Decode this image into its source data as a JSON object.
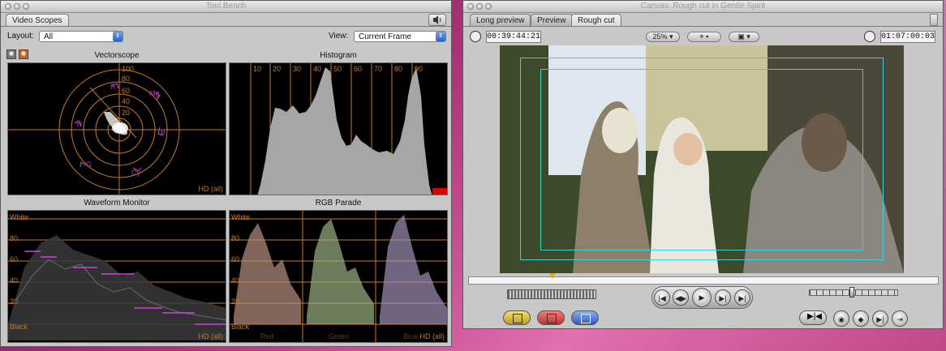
{
  "tool_bench": {
    "title": "Tool Bench",
    "tab": "Video Scopes",
    "layout_label": "Layout:",
    "layout_value": "All",
    "view_label": "View:",
    "view_value": "Current Frame",
    "vectorscope": {
      "title": "Vectorscope",
      "ring_labels": [
        "100",
        "80",
        "60",
        "40",
        "20"
      ],
      "targets": [
        "R",
        "Mg",
        "B",
        "Cy",
        "G",
        "Yl"
      ],
      "corner": "HD (all)"
    },
    "histogram": {
      "title": "Histogram",
      "ticks": [
        "10",
        "20",
        "30",
        "40",
        "50",
        "60",
        "70",
        "80",
        "90"
      ]
    },
    "waveform": {
      "title": "Waveform Monitor",
      "levels": [
        "White",
        "80",
        "60",
        "40",
        "20",
        "Black"
      ],
      "corner": "HD (all)"
    },
    "rgb_parade": {
      "title": "RGB Parade",
      "levels": [
        "White",
        "80",
        "60",
        "40",
        "20",
        "Black"
      ],
      "channels": [
        "Red",
        "Green",
        "Blue"
      ],
      "corner": "HD (all)"
    }
  },
  "canvas": {
    "title": "Canvas: Rough cut in Gentle Spirit",
    "tabs": [
      "Long preview",
      "Preview",
      "Rough cut"
    ],
    "active_tab": "Rough cut",
    "duration_tc": "00:39:44:21",
    "zoom": "25%",
    "current_tc": "01:07:00:03"
  },
  "colors": {
    "scope_orange": "#c87a28",
    "vectorscope_magenta": "#b040c0",
    "title_safe": "#3ad0d8"
  }
}
